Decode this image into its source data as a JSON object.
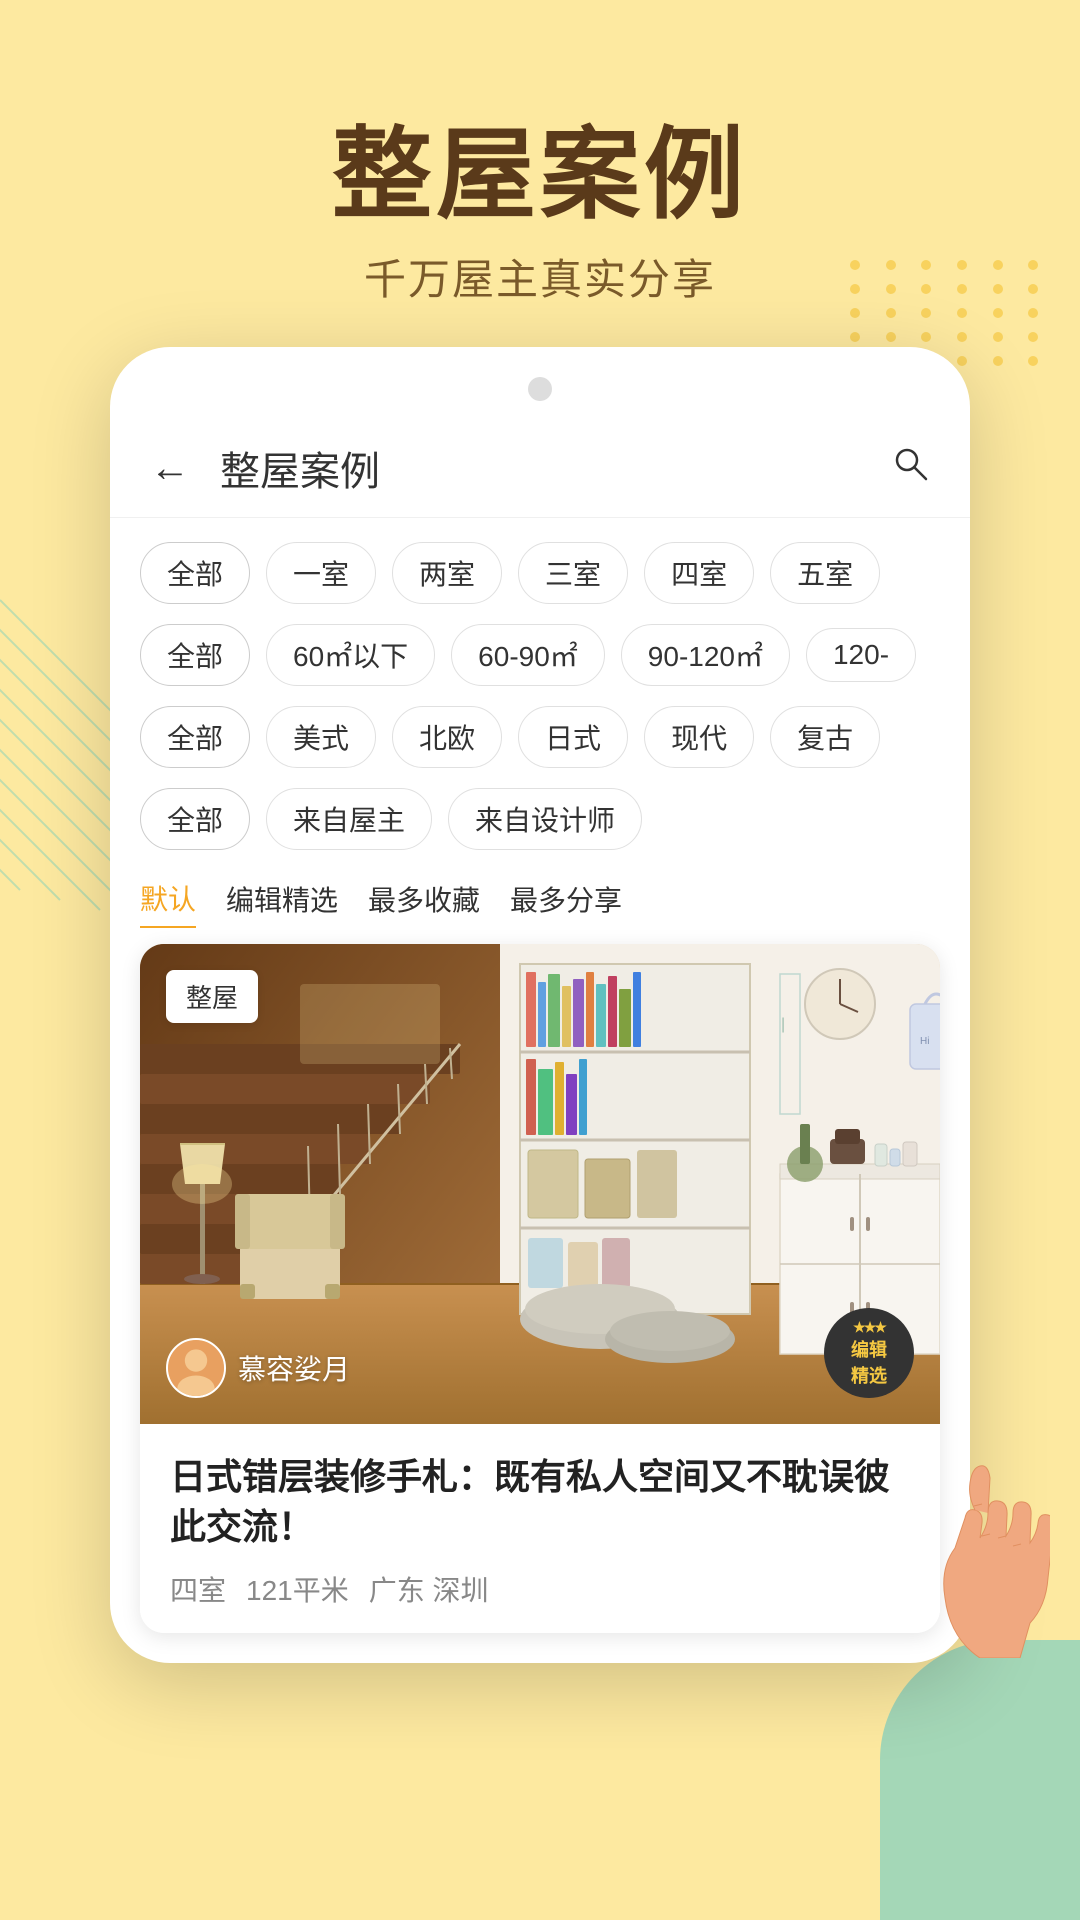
{
  "page": {
    "background_color": "#fde9a0",
    "main_title": "整屋案例",
    "sub_title": "千万屋主真实分享"
  },
  "nav": {
    "back_label": "←",
    "title": "整屋案例",
    "search_icon": "search"
  },
  "filters": {
    "row1": {
      "items": [
        "全部",
        "一室",
        "两室",
        "三室",
        "四室",
        "五室"
      ],
      "active": 0
    },
    "row2": {
      "items": [
        "全部",
        "60㎡以下",
        "60-90㎡",
        "90-120㎡",
        "120-"
      ],
      "active": 0
    },
    "row3": {
      "items": [
        "全部",
        "美式",
        "北欧",
        "日式",
        "现代",
        "复古"
      ],
      "active": 0
    },
    "row4": {
      "items": [
        "全部",
        "来自屋主",
        "来自设计师"
      ],
      "active": 0
    }
  },
  "sort": {
    "items": [
      "默认",
      "编辑精选",
      "最多收藏",
      "最多分享"
    ],
    "active": 0
  },
  "card": {
    "badge": "整屋",
    "editor_badge_line1": "编辑",
    "editor_badge_line2": "精选",
    "user_name": "慕容娑月",
    "title": "日式错层装修手札：既有私人空间又不耽误彼此交流！",
    "meta": {
      "rooms": "四室",
      "area": "121平米",
      "location": "广东 深圳"
    }
  }
}
